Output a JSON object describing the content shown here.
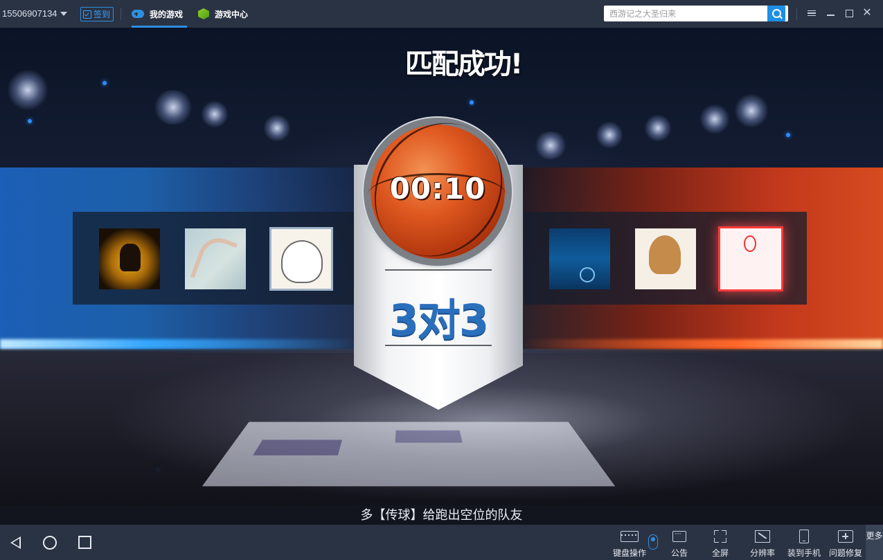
{
  "topbar": {
    "user_id": "15506907134",
    "signin_label": "签到",
    "tabs": [
      {
        "label": "我的游戏",
        "active": true,
        "icon": "gamepad-icon"
      },
      {
        "label": "游戏中心",
        "active": false,
        "icon": "cube-icon"
      }
    ],
    "search": {
      "placeholder": "西游记之大圣归来"
    },
    "window_controls": [
      "menu-icon",
      "minimize-icon",
      "maximize-icon",
      "close-icon"
    ]
  },
  "game": {
    "title": "匹配成功!",
    "timer": "00:10",
    "mode": "3对3",
    "tip": "多【传球】给跑出空位的队友",
    "left_team": {
      "color": "#1f6fd0",
      "players": 3
    },
    "right_team": {
      "color": "#d6401c",
      "players": 3
    }
  },
  "bottombar": {
    "nav": [
      "back-icon",
      "home-icon",
      "recent-apps-icon"
    ],
    "tools": [
      {
        "label": "键盘操作",
        "icon": "keyboard-icon"
      },
      {
        "label": "公告",
        "icon": "notice-icon"
      },
      {
        "label": "全屏",
        "icon": "fullscreen-icon"
      },
      {
        "label": "分辨率",
        "icon": "resolution-icon"
      },
      {
        "label": "装到手机",
        "icon": "phone-icon"
      },
      {
        "label": "问题修复",
        "icon": "repair-icon"
      }
    ],
    "more_label": "更多"
  },
  "colors": {
    "accent": "#2e8fe0",
    "toolbar_bg": "#2a3344"
  }
}
